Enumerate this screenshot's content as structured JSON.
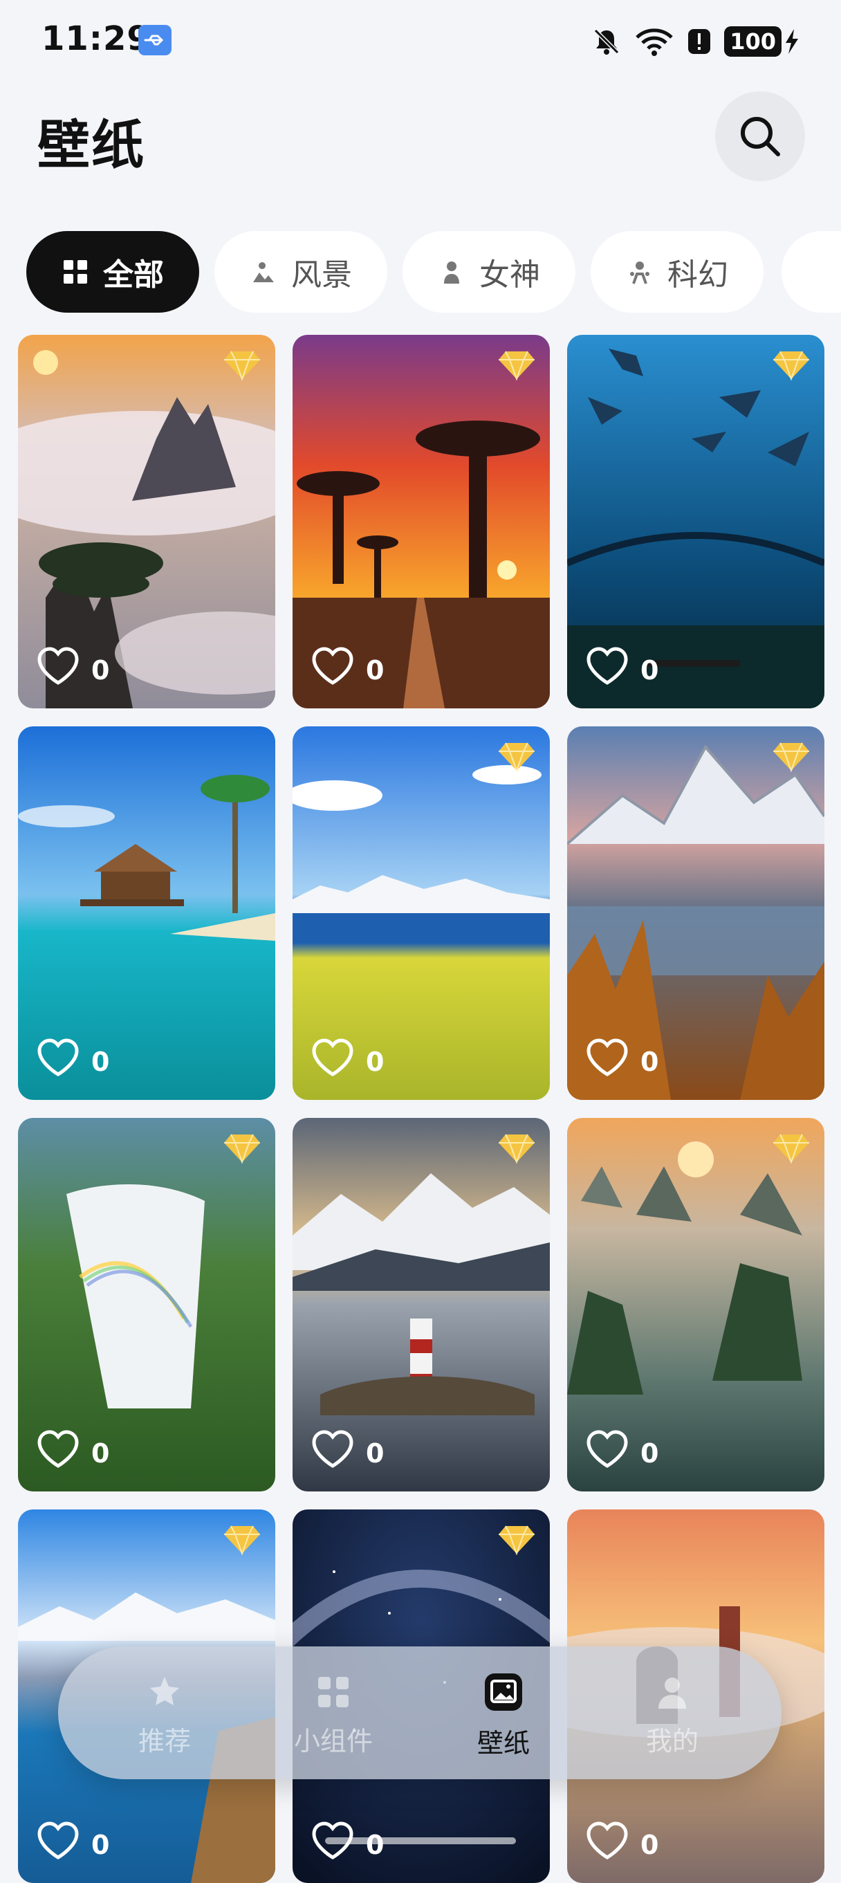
{
  "status_bar": {
    "time": "11:29",
    "battery": "100",
    "icons": [
      "usb-icon",
      "bell-muted-icon",
      "wifi-icon",
      "alert-icon",
      "battery-icon",
      "charging-icon"
    ]
  },
  "header": {
    "title": "壁纸",
    "search_icon": "search-icon"
  },
  "categories": [
    {
      "label": "全部",
      "icon": "grid-icon",
      "active": true
    },
    {
      "label": "风景",
      "icon": "landscape-icon",
      "active": false
    },
    {
      "label": "女神",
      "icon": "person-icon",
      "active": false
    },
    {
      "label": "科幻",
      "icon": "scifi-icon",
      "active": false
    }
  ],
  "wallpapers": [
    {
      "likes": "0",
      "vip": true,
      "subject": "sea of clouds mountains"
    },
    {
      "likes": "0",
      "vip": true,
      "subject": "baobab sunset road"
    },
    {
      "likes": "0",
      "vip": true,
      "subject": "underwater manta rays"
    },
    {
      "likes": "0",
      "vip": false,
      "subject": "tropical water villa"
    },
    {
      "likes": "0",
      "vip": true,
      "subject": "lake rapeseed field"
    },
    {
      "likes": "0",
      "vip": true,
      "subject": "mountain lake autumn"
    },
    {
      "likes": "0",
      "vip": true,
      "subject": "waterfall rainbow"
    },
    {
      "likes": "0",
      "vip": true,
      "subject": "lighthouse island"
    },
    {
      "likes": "0",
      "vip": true,
      "subject": "karst bay boats"
    },
    {
      "likes": "0",
      "vip": true,
      "subject": "coast snow mountains"
    },
    {
      "likes": "0",
      "vip": true,
      "subject": "milky way night"
    },
    {
      "likes": "0",
      "vip": false,
      "subject": "castle misty sunset"
    }
  ],
  "bottom_nav": [
    {
      "label": "推荐",
      "icon": "recommend-icon",
      "active": false
    },
    {
      "label": "小组件",
      "icon": "widgets-icon",
      "active": false
    },
    {
      "label": "壁纸",
      "icon": "wallpaper-icon",
      "active": true
    },
    {
      "label": "我的",
      "icon": "profile-icon",
      "active": false
    }
  ],
  "colors": {
    "background": "#f4f5f9",
    "chip_active": "#111111",
    "vip_gold": "#f5c542"
  }
}
